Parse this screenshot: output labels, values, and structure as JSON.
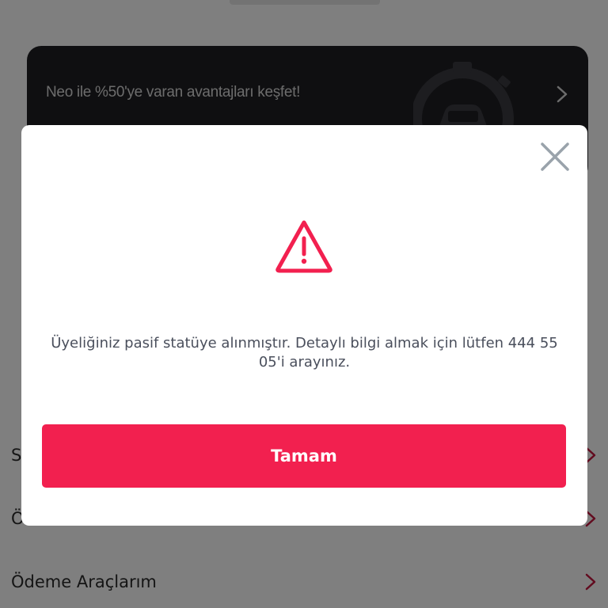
{
  "promo": {
    "text": "Neo ile %50'ye varan avantajları keşfet!",
    "chevron_icon": "chevron-right-icon",
    "watch_icon": "stopwatch-car-icon"
  },
  "menu": {
    "items": [
      {
        "label": "S"
      },
      {
        "label": "Ö"
      },
      {
        "label": "Ödeme Araçlarım"
      }
    ],
    "chevron_color": "#c4173f"
  },
  "modal": {
    "close_icon": "close-icon",
    "warning_icon": "warning-triangle-icon",
    "message": "Üyeliğiniz pasif statüye alınmıştır. Detaylı bilgi almak için lütfen 444 55 05'i arayınız.",
    "ok_label": "Tamam"
  },
  "colors": {
    "accent": "#f2204f",
    "banner_bg": "#1f1f23",
    "overlay": "rgba(0,0,0,0.5)"
  }
}
